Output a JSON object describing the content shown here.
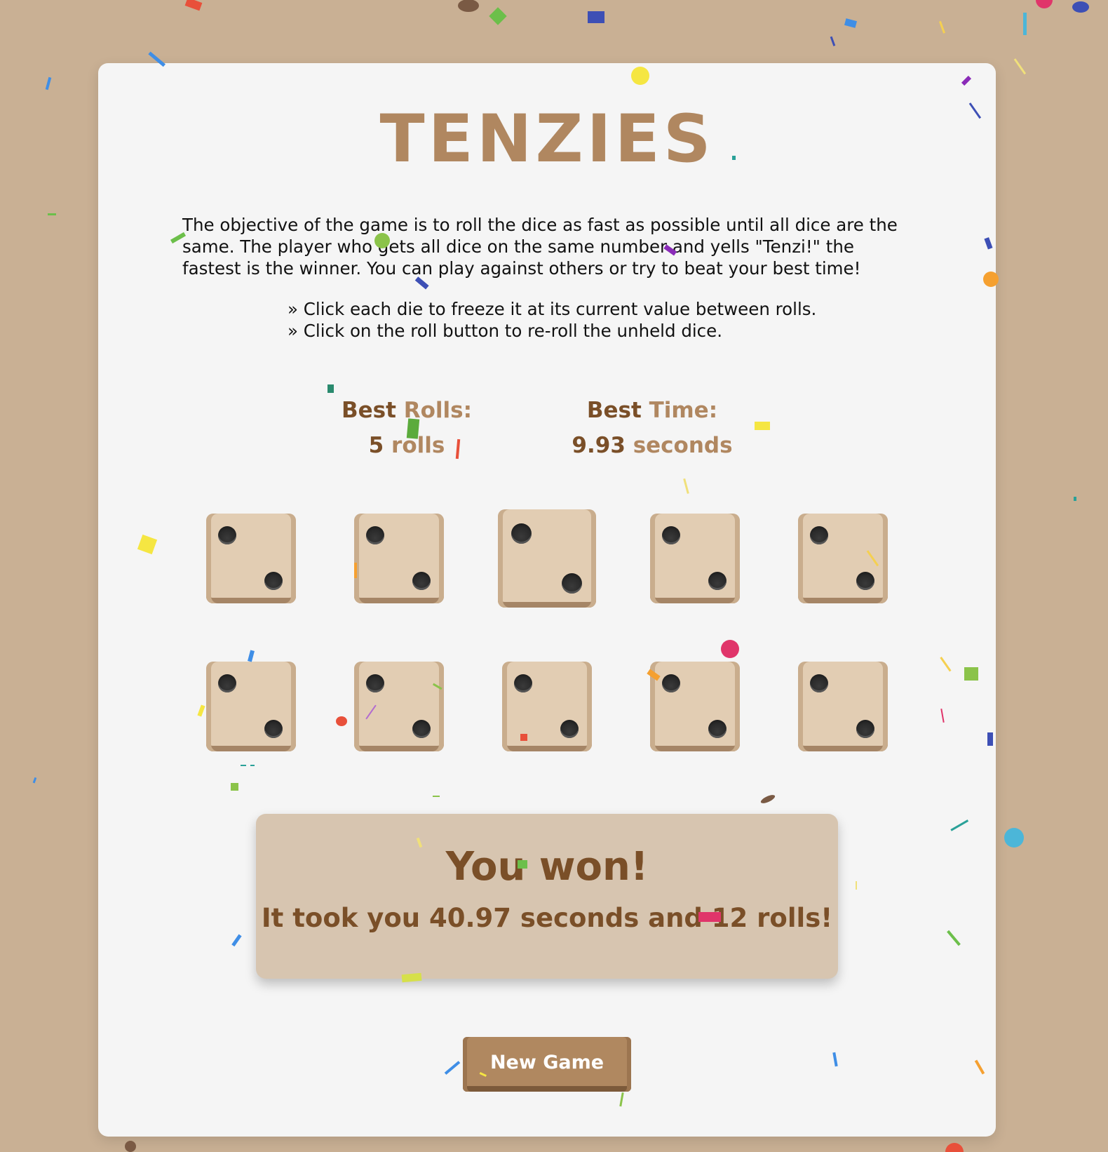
{
  "game": {
    "title": "TENZIES",
    "intro": "The objective of the game is to roll the dice as fast as possible until all dice are the same. The player who gets all dice on the same number and yells \"Tenzi!\" the fastest is the winner. You can play against others or try to beat your best time!",
    "rules": [
      "» Click each die to freeze it at its current value between rolls.",
      "» Click on the roll button to re-roll the unheld dice."
    ]
  },
  "stats": {
    "best_rolls_label_a": "Best",
    "best_rolls_label_b": "Rolls:",
    "best_rolls_value": "5",
    "best_rolls_unit": "rolls",
    "best_time_label_a": "Best",
    "best_time_label_b": "Time:",
    "best_time_value": "9.93",
    "best_time_unit": "seconds"
  },
  "dice": [
    {
      "value": 2,
      "held": false
    },
    {
      "value": 2,
      "held": false
    },
    {
      "value": 2,
      "held": false
    },
    {
      "value": 2,
      "held": false
    },
    {
      "value": 2,
      "held": false
    },
    {
      "value": 2,
      "held": false
    },
    {
      "value": 2,
      "held": false
    },
    {
      "value": 2,
      "held": false
    },
    {
      "value": 2,
      "held": false
    },
    {
      "value": 2,
      "held": false
    }
  ],
  "result": {
    "title": "You won!",
    "detail": "It took you 40.97 seconds and 12 rolls!"
  },
  "controls": {
    "new_game_label": "New Game"
  },
  "colors": {
    "background": "#c9b094",
    "card": "#f5f5f5",
    "accent": "#b08760",
    "dark_brown": "#7a4f28",
    "die_face": "#e2cdb3",
    "win_box": "#d7c5b0"
  }
}
